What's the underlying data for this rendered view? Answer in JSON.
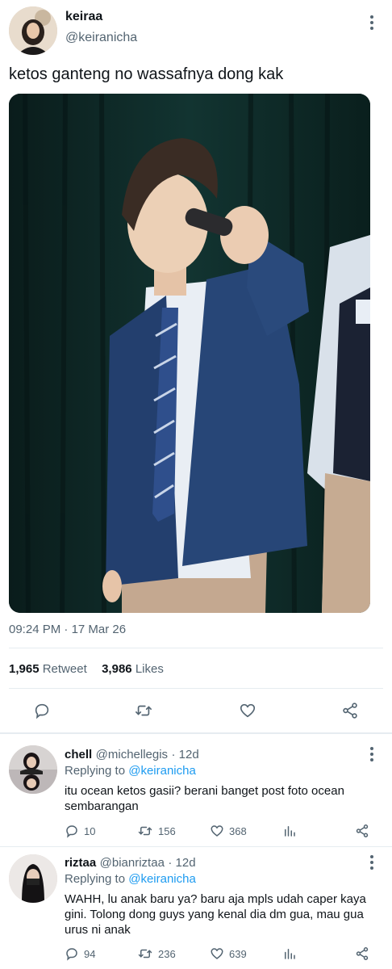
{
  "tweet": {
    "display_name": "keiraa",
    "handle": "@keiranicha",
    "text": "ketos ganteng no wassafnya dong kak",
    "time": "09:24 PM",
    "date_separator": " · ",
    "date": "17 Mar 26",
    "retweets_count": "1,965",
    "retweets_label": "Retweet",
    "likes_count": "3,986",
    "likes_label": "Likes",
    "actions": [
      "reply-icon",
      "retweet-icon",
      "heart-icon",
      "share-icon"
    ]
  },
  "replies": [
    {
      "display_name": "chell",
      "handle": "@michellegis",
      "time": "· 12d",
      "replying_prefix": "Replying to",
      "replying_to": "@keiranicha",
      "text": "itu ocean ketos gasii? berani banget post foto ocean sembarangan",
      "reply_count": "10",
      "retweet_count": "156",
      "like_count": "368"
    },
    {
      "display_name": "riztaa",
      "handle": "@bianriztaa",
      "time": "· 12d",
      "replying_prefix": "Replying to",
      "replying_to": "@keiranicha",
      "text": "WAHH, lu anak baru ya? baru aja mpls udah caper kaya gini. Tolong dong guys yang kenal dia dm gua, mau gua urus ni anak",
      "reply_count": "94",
      "retweet_count": "236",
      "like_count": "639"
    }
  ],
  "colors": {
    "accent": "#1d9bf0",
    "text": "#0f1419",
    "muted": "#536471",
    "divider": "#e6ecf0"
  }
}
